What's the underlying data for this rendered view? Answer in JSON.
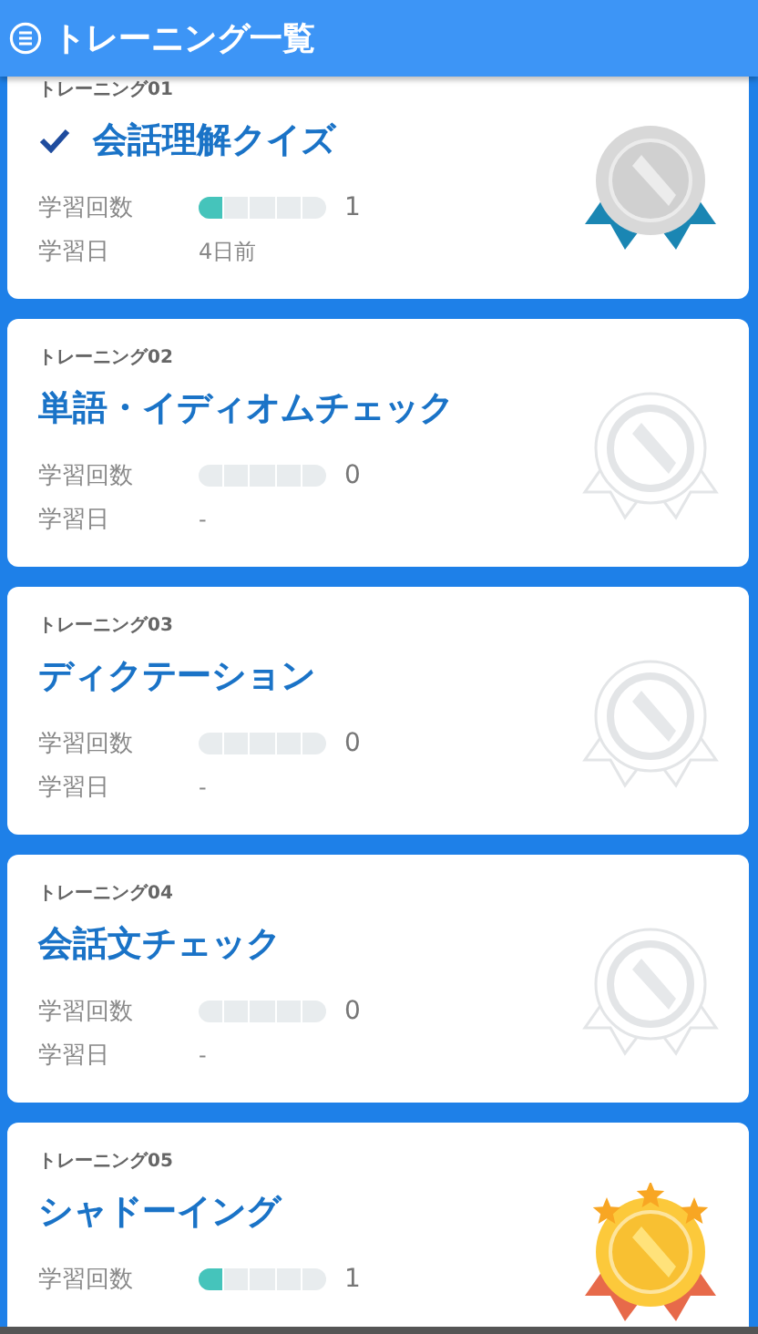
{
  "header": {
    "title": "トレーニング一覧"
  },
  "trainings": [
    {
      "label": "トレーニング01",
      "title": "会話理解クイズ",
      "checked": true,
      "kind": "silver",
      "rows": [
        {
          "kind": "progress",
          "label": "学習回数",
          "level": 0.2,
          "value": "1"
        },
        {
          "kind": "text",
          "label": "学習日",
          "value": "4日前"
        }
      ]
    },
    {
      "label": "トレーニング02",
      "title": "単語・イディオムチェック",
      "checked": false,
      "kind": "none",
      "rows": [
        {
          "kind": "progress",
          "label": "学習回数",
          "level": 0,
          "value": "0"
        },
        {
          "kind": "text",
          "label": "学習日",
          "value": "-"
        }
      ]
    },
    {
      "label": "トレーニング03",
      "title": "ディクテーション",
      "checked": false,
      "kind": "none",
      "rows": [
        {
          "kind": "progress",
          "label": "学習回数",
          "level": 0,
          "value": "0"
        },
        {
          "kind": "text",
          "label": "学習日",
          "value": "-"
        }
      ]
    },
    {
      "label": "トレーニング04",
      "title": "会話文チェック",
      "checked": false,
      "kind": "none",
      "rows": [
        {
          "kind": "progress",
          "label": "学習回数",
          "level": 0,
          "value": "0"
        },
        {
          "kind": "text",
          "label": "学習日",
          "value": "-"
        }
      ]
    },
    {
      "label": "トレーニング05",
      "title": "シャドーイング",
      "checked": false,
      "kind": "gold",
      "rows": [
        {
          "kind": "progress",
          "label": "学習回数",
          "level": 0.2,
          "value": "1"
        }
      ]
    }
  ]
}
